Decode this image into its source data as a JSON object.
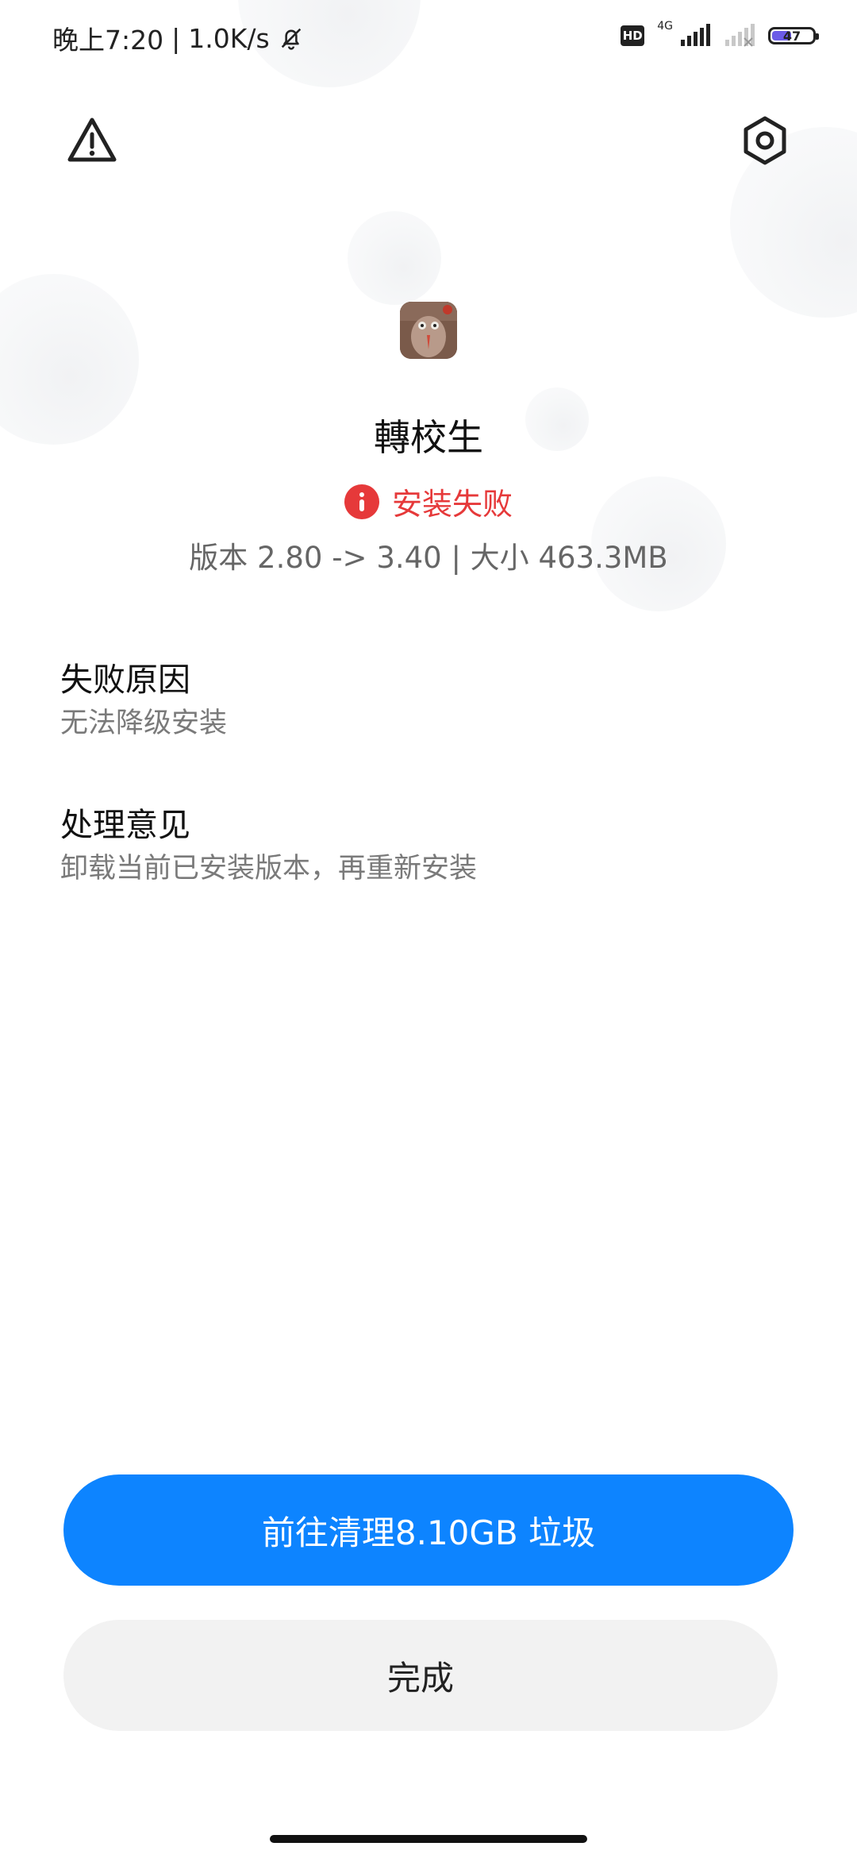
{
  "status_bar": {
    "time": "晚上7:20",
    "separator": "|",
    "net_speed": "1.0K/s",
    "hd_label": "HD",
    "network_type": "4G",
    "battery_level": "47",
    "battery_fraction": 0.47,
    "icons": [
      "bell-off-icon",
      "signal-icon",
      "signal-disabled-icon",
      "battery-icon"
    ]
  },
  "toolbar": {
    "left_icon": "warning-triangle-icon",
    "right_icon": "settings-gear-icon"
  },
  "app": {
    "name": "轉校生",
    "status": "安装失败",
    "status_color": "#e6393a",
    "version_info": "版本 2.80 -> 3.40 | 大小 463.3MB"
  },
  "failure": {
    "reason_title": "失败原因",
    "reason_text": "无法降级安装",
    "advice_title": "处理意见",
    "advice_text": "卸载当前已安装版本，再重新安装"
  },
  "actions": {
    "clean_label": "前往清理8.10GB 垃圾",
    "clean_color": "#0d84ff",
    "done_label": "完成"
  }
}
